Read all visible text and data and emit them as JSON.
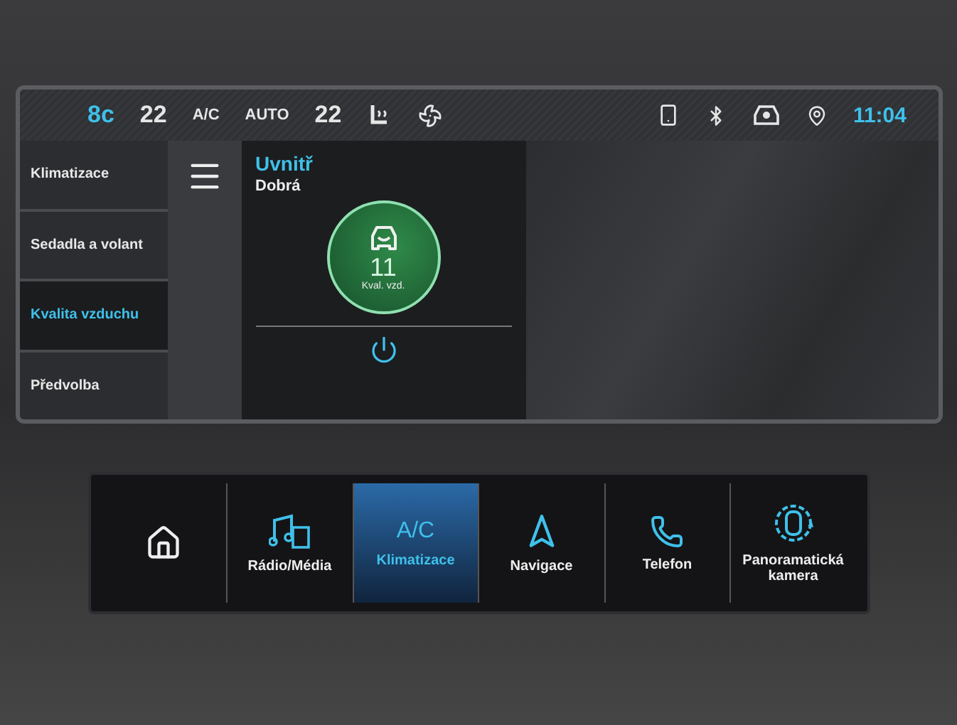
{
  "status_bar": {
    "outside_temp": "8c",
    "left_temp": "22",
    "ac": "A/C",
    "mode": "AUTO",
    "right_temp": "22",
    "time": "11:04"
  },
  "side_menu": [
    {
      "label": "Klimatizace",
      "selected": false
    },
    {
      "label": "Sedadla a volant",
      "selected": false
    },
    {
      "label": "Kvalita vzduchu",
      "selected": true
    },
    {
      "label": "Předvolba",
      "selected": false
    }
  ],
  "air_quality": {
    "title": "Uvnitř",
    "status": "Dobrá",
    "value": "11",
    "caption": "Kval. vzd."
  },
  "dock": [
    {
      "kind": "home",
      "selected": false
    },
    {
      "kind": "media",
      "label": "Rádio/Média",
      "selected": false
    },
    {
      "kind": "ac",
      "symbol": "A/C",
      "label": "Klimatizace",
      "selected": true
    },
    {
      "kind": "navigation",
      "label": "Navigace",
      "selected": false
    },
    {
      "kind": "phone",
      "label": "Telefon",
      "selected": false
    },
    {
      "kind": "camera",
      "label": "Panoramatická kamera",
      "selected": false
    }
  ]
}
